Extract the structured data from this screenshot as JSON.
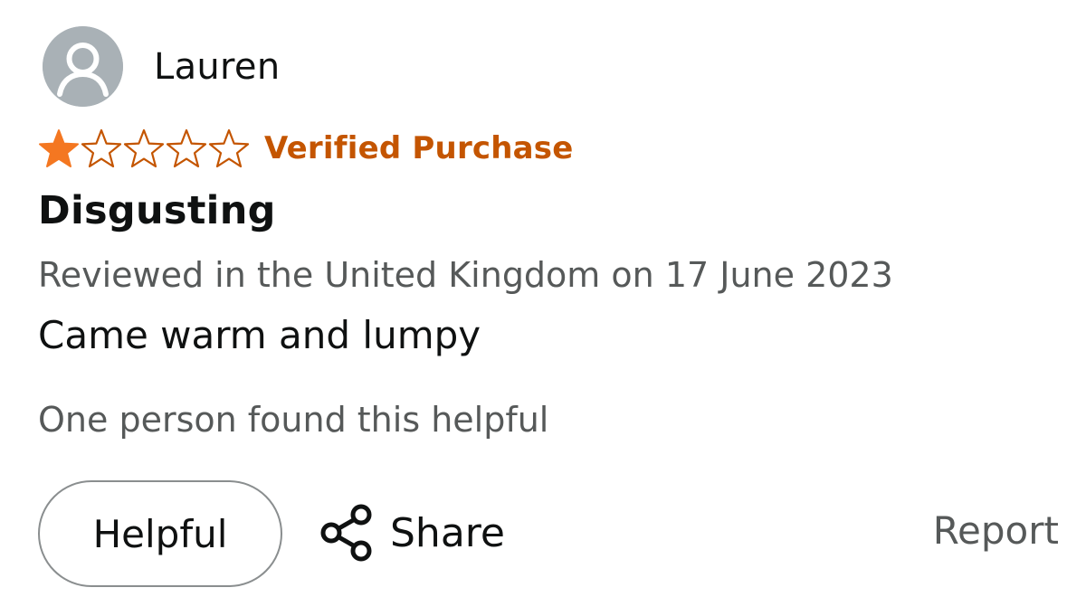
{
  "review": {
    "author": {
      "name": "Lauren",
      "avatar_icon": "default-user-avatar-icon"
    },
    "rating": {
      "value": 1,
      "max": 5,
      "filled_color": "#f47721",
      "empty_color": "#c45500"
    },
    "verified_label": "Verified Purchase",
    "title": "Disgusting",
    "meta": "Reviewed in the United Kingdom on 17 June 2023",
    "body": "Came warm and lumpy",
    "helpful_count_text": "One person found this helpful",
    "actions": {
      "helpful_label": "Helpful",
      "share_label": "Share",
      "share_icon": "share-icon",
      "report_label": "Report"
    }
  }
}
